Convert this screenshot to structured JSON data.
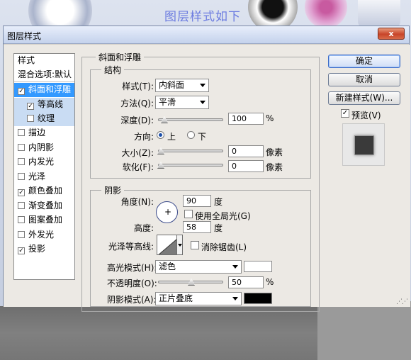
{
  "background": {
    "watermark": "图层样式如下"
  },
  "dialog": {
    "title": "图层样式",
    "close_label": "x"
  },
  "left_panel": {
    "items": [
      {
        "label": "样式",
        "checkbox": false,
        "checked": false
      },
      {
        "label": "混合选项:默认",
        "checkbox": false,
        "checked": false
      },
      {
        "label": "斜面和浮雕",
        "checkbox": true,
        "checked": true,
        "selected": true
      },
      {
        "label": "等高线",
        "checkbox": true,
        "checked": true
      },
      {
        "label": "纹理",
        "checkbox": true,
        "checked": false
      },
      {
        "label": "描边",
        "checkbox": true,
        "checked": false
      },
      {
        "label": "内阴影",
        "checkbox": true,
        "checked": false
      },
      {
        "label": "内发光",
        "checkbox": true,
        "checked": false
      },
      {
        "label": "光泽",
        "checkbox": true,
        "checked": false
      },
      {
        "label": "颜色叠加",
        "checkbox": true,
        "checked": true
      },
      {
        "label": "渐变叠加",
        "checkbox": true,
        "checked": false
      },
      {
        "label": "图案叠加",
        "checkbox": true,
        "checked": false
      },
      {
        "label": "外发光",
        "checkbox": true,
        "checked": false
      },
      {
        "label": "投影",
        "checkbox": true,
        "checked": true
      }
    ]
  },
  "bevel": {
    "section_title": "斜面和浮雕",
    "structure_title": "结构",
    "style_label": "样式(T):",
    "style_value": "内斜面",
    "technique_label": "方法(Q):",
    "technique_value": "平滑",
    "depth_label": "深度(D):",
    "depth_value": "100",
    "depth_unit": "%",
    "direction_label": "方向:",
    "dir_up": "上",
    "dir_down": "下",
    "size_label": "大小(Z):",
    "size_value": "0",
    "size_unit": "像素",
    "soften_label": "软化(F):",
    "soften_value": "0",
    "soften_unit": "像素"
  },
  "shading": {
    "title": "阴影",
    "angle_label": "角度(N):",
    "angle_value": "90",
    "angle_unit": "度",
    "global_light_label": "使用全局光(G)",
    "altitude_label": "高度:",
    "altitude_value": "58",
    "altitude_unit": "度",
    "gloss_label": "光泽等高线:",
    "antialias_label": "消除锯齿(L)",
    "highlight_label": "高光模式(H):",
    "highlight_value": "滤色",
    "highlight_color": "#ffffff",
    "opacity_label": "不透明度(O):",
    "opacity_value": "50",
    "opacity_unit": "%",
    "shadow_label": "阴影模式(A):",
    "shadow_value": "正片叠底",
    "shadow_color": "#000000"
  },
  "buttons": {
    "ok": "确定",
    "cancel": "取消",
    "new_style": "新建样式(W)...",
    "preview": "预览(V)",
    "preview_checked": "✓"
  }
}
